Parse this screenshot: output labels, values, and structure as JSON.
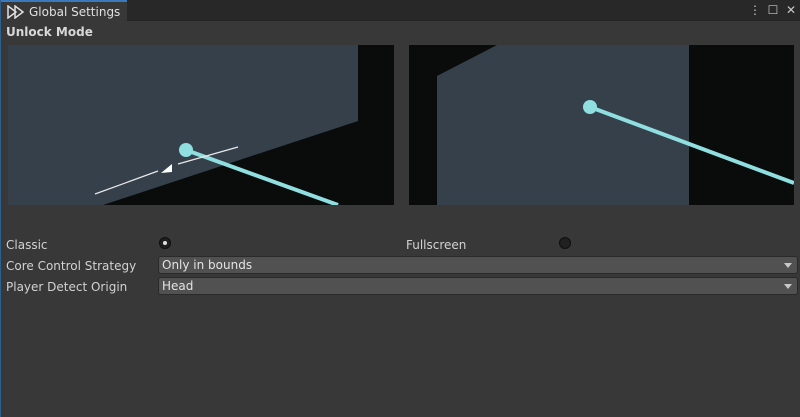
{
  "tab": {
    "title": "Global Settings",
    "icon": "play-forward-icon"
  },
  "window_controls": {
    "menu": "⋮",
    "maximize": "☐",
    "close": "✕"
  },
  "section": {
    "title": "Unlock Mode"
  },
  "colors": {
    "panel": "#35404b",
    "ray": "#8fdfe0",
    "background": "#0a0c0c"
  },
  "options": {
    "classic": {
      "label": "Classic",
      "checked": true
    },
    "fullscreen": {
      "label": "Fullscreen",
      "checked": false
    }
  },
  "fields": {
    "core_control_strategy": {
      "label": "Core Control Strategy",
      "value": "Only in bounds"
    },
    "player_detect_origin": {
      "label": "Player Detect Origin",
      "value": "Head"
    }
  }
}
